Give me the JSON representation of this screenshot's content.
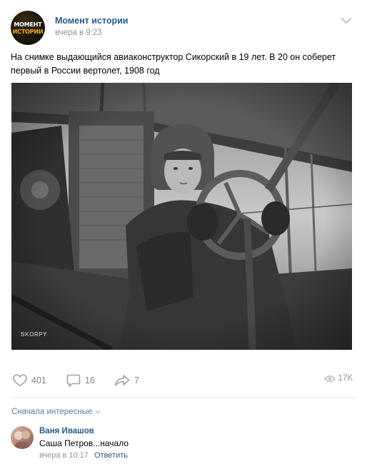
{
  "post": {
    "avatar_line1": "МОМЕНТ",
    "avatar_line2": "ИСТОРИИ",
    "author": "Момент истории",
    "time": "вчера в 9:23",
    "text": "На снимке выдающийся авиаконструктор Сикорский в 19 лет. В 20 он соберет первый в России вертолет, 1908 год",
    "image_watermark": "SKORPY"
  },
  "actions": {
    "likes": "401",
    "comments": "16",
    "shares": "7",
    "views": "17K"
  },
  "comments": {
    "sort_label": "Сначала интересные",
    "items": [
      {
        "author": "Ваня Ивашов",
        "text": "Саша Петров...начало",
        "time": "вчера в 10:17",
        "reply_label": "Ответить"
      }
    ]
  },
  "icons": {
    "like": "heart-icon",
    "comment": "comment-bubble-icon",
    "share": "share-arrow-icon",
    "views": "eye-icon",
    "menu": "chevron-down-icon"
  },
  "colors": {
    "link": "#2a5885",
    "muted": "#939393",
    "sort_link": "#5b7ca3"
  }
}
